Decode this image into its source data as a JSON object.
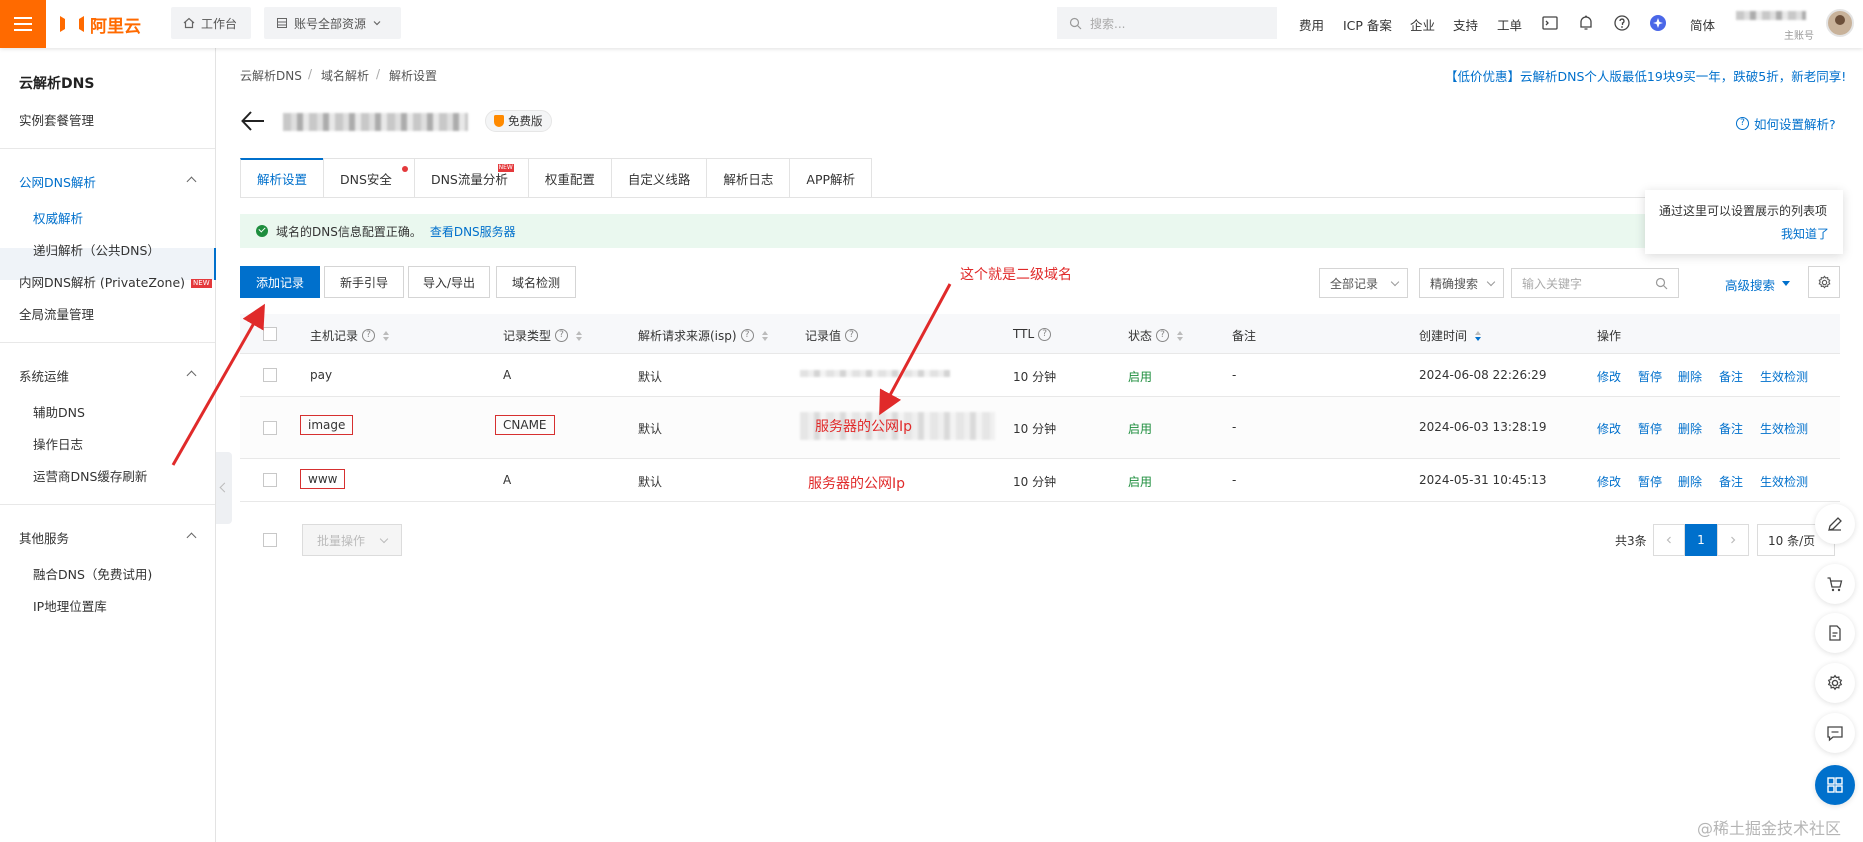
{
  "topbar": {
    "logo_text": "阿里云",
    "workbench": "工作台",
    "resources": "账号全部资源",
    "search_placeholder": "搜索...",
    "links": [
      "费用",
      "ICP 备案",
      "企业",
      "支持",
      "工单"
    ],
    "language": "简体",
    "account_role": "主账号"
  },
  "sidebar": {
    "title": "云解析DNS",
    "instance": "实例套餐管理",
    "public_group": "公网DNS解析",
    "public_items": [
      "权威解析",
      "递归解析（公共DNS）"
    ],
    "private_zone": "内网DNS解析 (PrivateZone)",
    "new_badge": "NEW",
    "global_traffic": "全局流量管理",
    "ops_group": "系统运维",
    "ops_items": [
      "辅助DNS",
      "操作日志",
      "运营商DNS缓存刷新"
    ],
    "other_group": "其他服务",
    "other_items": [
      "融合DNS（免费试用)",
      "IP地理位置库"
    ]
  },
  "breadcrumb": [
    "云解析DNS",
    "域名解析",
    "解析设置"
  ],
  "promo": "【低价优惠】云解析DNS个人版最低19块9买一年，跌破5折，新老同享!",
  "header": {
    "plan_badge": "免费版",
    "help_link": "如何设置解析?"
  },
  "tabs": [
    {
      "label": "解析设置",
      "active": true
    },
    {
      "label": "DNS安全",
      "dot": true
    },
    {
      "label": "DNS流量分析",
      "new": "NEW"
    },
    {
      "label": "权重配置"
    },
    {
      "label": "自定义线路"
    },
    {
      "label": "解析日志"
    },
    {
      "label": "APP解析"
    }
  ],
  "notice": {
    "text": "域名的DNS信息配置正确。",
    "link": "查看DNS服务器"
  },
  "tooltip": {
    "text": "通过这里可以设置展示的列表项",
    "ok": "我知道了"
  },
  "toolbar": {
    "add": "添加记录",
    "guide": "新手引导",
    "import_export": "导入/导出",
    "domain_check": "域名检测",
    "record_filter": "全部记录",
    "search_mode": "精确搜索",
    "keyword_placeholder": "输入关键字",
    "advanced": "高级搜索"
  },
  "table": {
    "headers": {
      "host": "主机记录",
      "type": "记录类型",
      "isp": "解析请求来源(isp)",
      "value": "记录值",
      "ttl": "TTL",
      "status": "状态",
      "remark": "备注",
      "created": "创建时间",
      "actions": "操作"
    },
    "rows": [
      {
        "host": "pay",
        "type": "A",
        "isp": "默认",
        "value_note": "",
        "ttl": "10 分钟",
        "status": "启用",
        "remark": "-",
        "created": "2024-06-08 22:26:29"
      },
      {
        "host": "image",
        "type": "CNAME",
        "isp": "默认",
        "value_note": "服务器的公网Ip",
        "ttl": "10 分钟",
        "status": "启用",
        "remark": "-",
        "created": "2024-06-03 13:28:19"
      },
      {
        "host": "www",
        "type": "A",
        "isp": "默认",
        "value_note": "服务器的公网Ip",
        "ttl": "10 分钟",
        "status": "启用",
        "remark": "-",
        "created": "2024-05-31 10:45:13"
      }
    ],
    "row_actions": [
      "修改",
      "暂停",
      "删除",
      "备注",
      "生效检测"
    ]
  },
  "annotation": {
    "label": "这个就是二级域名",
    "color": "#e02a2a"
  },
  "footer": {
    "batch": "批量操作",
    "total": "共3条",
    "current_page": "1",
    "page_size": "10 条/页"
  },
  "watermark": "@稀土掘金技术社区",
  "colors": {
    "brand": "#ff6a00",
    "primary": "#0070cc",
    "success": "#1e8e3e"
  }
}
